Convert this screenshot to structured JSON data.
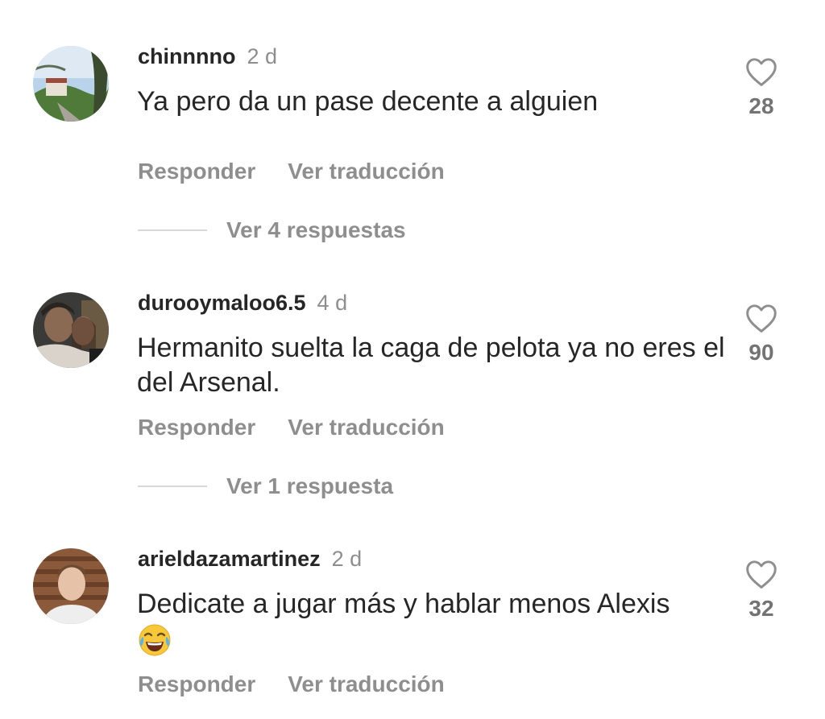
{
  "comments": [
    {
      "username": "chinnnno",
      "time": "2 d",
      "text": "Ya pero da un pase decente a alguien",
      "likes": "28",
      "reply_label": "Responder",
      "translate_label": "Ver traducción",
      "view_replies": "Ver 4 respuestas"
    },
    {
      "username": "durooymaloo6.5",
      "time": "4 d",
      "text": "Hermanito suelta la caga de pelota ya no eres el del Arsenal.",
      "likes": "90",
      "reply_label": "Responder",
      "translate_label": "Ver traducción",
      "view_replies": "Ver 1 respuesta"
    },
    {
      "username": "arieldazamartinez",
      "time": "2 d",
      "text": "Dedicate a jugar más y hablar menos Alexis",
      "emoji": "face-with-tears-of-joy",
      "likes": "32",
      "reply_label": "Responder",
      "translate_label": "Ver traducción"
    }
  ],
  "colors": {
    "username": "#262626",
    "secondary": "#8e8e8e",
    "divider": "#d8d8d8"
  }
}
